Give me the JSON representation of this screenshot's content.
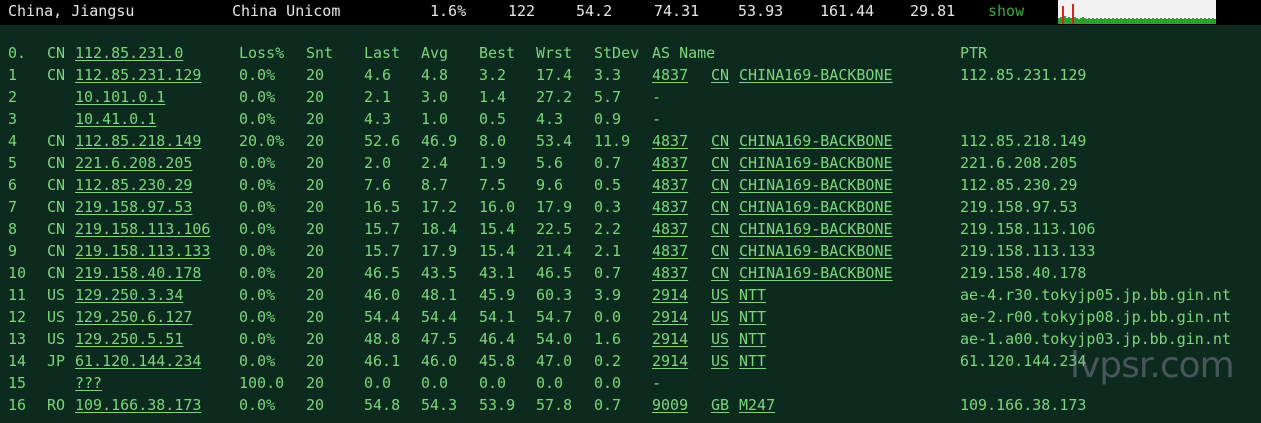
{
  "summary": {
    "location": "China, Jiangsu",
    "isp": "China Unicom",
    "loss": "1.6%",
    "sent": "122",
    "last": "54.2",
    "avg": "74.31",
    "best": "53.93",
    "worst": "161.44",
    "stdev": "29.81",
    "show_label": "show"
  },
  "headers": {
    "hop": "0.",
    "cc": "CN",
    "host": "112.85.231.0",
    "loss": "Loss%",
    "snt": "Snt",
    "last": "Last",
    "avg": "Avg",
    "best": "Best",
    "wrst": "Wrst",
    "stdev": "StDev",
    "asname": "AS Name",
    "ptr": "PTR"
  },
  "hops": [
    {
      "hop": "1",
      "cc": "CN",
      "host": "112.85.231.129",
      "loss": "0.0%",
      "snt": "20",
      "last": "4.6",
      "avg": "4.8",
      "best": "3.2",
      "wrst": "17.4",
      "stdev": "3.3",
      "asn": "4837",
      "ascc": "CN",
      "asname": "CHINA169-BACKBONE",
      "ptr": "112.85.231.129"
    },
    {
      "hop": "2",
      "cc": "",
      "host": "10.101.0.1",
      "loss": "0.0%",
      "snt": "20",
      "last": "2.1",
      "avg": "3.0",
      "best": "1.4",
      "wrst": "27.2",
      "stdev": "5.7",
      "asn": "-",
      "ascc": "",
      "asname": "",
      "ptr": ""
    },
    {
      "hop": "3",
      "cc": "",
      "host": "10.41.0.1",
      "loss": "0.0%",
      "snt": "20",
      "last": "4.3",
      "avg": "1.0",
      "best": "0.5",
      "wrst": "4.3",
      "stdev": "0.9",
      "asn": "-",
      "ascc": "",
      "asname": "",
      "ptr": ""
    },
    {
      "hop": "4",
      "cc": "CN",
      "host": "112.85.218.149",
      "loss": "20.0%",
      "snt": "20",
      "last": "52.6",
      "avg": "46.9",
      "best": "8.0",
      "wrst": "53.4",
      "stdev": "11.9",
      "asn": "4837",
      "ascc": "CN",
      "asname": "CHINA169-BACKBONE",
      "ptr": "112.85.218.149"
    },
    {
      "hop": "5",
      "cc": "CN",
      "host": "221.6.208.205",
      "loss": "0.0%",
      "snt": "20",
      "last": "2.0",
      "avg": "2.4",
      "best": "1.9",
      "wrst": "5.6",
      "stdev": "0.7",
      "asn": "4837",
      "ascc": "CN",
      "asname": "CHINA169-BACKBONE",
      "ptr": "221.6.208.205"
    },
    {
      "hop": "6",
      "cc": "CN",
      "host": "112.85.230.29",
      "loss": "0.0%",
      "snt": "20",
      "last": "7.6",
      "avg": "8.7",
      "best": "7.5",
      "wrst": "9.6",
      "stdev": "0.5",
      "asn": "4837",
      "ascc": "CN",
      "asname": "CHINA169-BACKBONE",
      "ptr": "112.85.230.29"
    },
    {
      "hop": "7",
      "cc": "CN",
      "host": "219.158.97.53",
      "loss": "0.0%",
      "snt": "20",
      "last": "16.5",
      "avg": "17.2",
      "best": "16.0",
      "wrst": "17.9",
      "stdev": "0.3",
      "asn": "4837",
      "ascc": "CN",
      "asname": "CHINA169-BACKBONE",
      "ptr": "219.158.97.53"
    },
    {
      "hop": "8",
      "cc": "CN",
      "host": "219.158.113.106",
      "loss": "0.0%",
      "snt": "20",
      "last": "15.7",
      "avg": "18.4",
      "best": "15.4",
      "wrst": "22.5",
      "stdev": "2.2",
      "asn": "4837",
      "ascc": "CN",
      "asname": "CHINA169-BACKBONE",
      "ptr": "219.158.113.106"
    },
    {
      "hop": "9",
      "cc": "CN",
      "host": "219.158.113.133",
      "loss": "0.0%",
      "snt": "20",
      "last": "15.7",
      "avg": "17.9",
      "best": "15.4",
      "wrst": "21.4",
      "stdev": "2.1",
      "asn": "4837",
      "ascc": "CN",
      "asname": "CHINA169-BACKBONE",
      "ptr": "219.158.113.133"
    },
    {
      "hop": "10",
      "cc": "CN",
      "host": "219.158.40.178",
      "loss": "0.0%",
      "snt": "20",
      "last": "46.5",
      "avg": "43.5",
      "best": "43.1",
      "wrst": "46.5",
      "stdev": "0.7",
      "asn": "4837",
      "ascc": "CN",
      "asname": "CHINA169-BACKBONE",
      "ptr": "219.158.40.178"
    },
    {
      "hop": "11",
      "cc": "US",
      "host": "129.250.3.34",
      "loss": "0.0%",
      "snt": "20",
      "last": "46.0",
      "avg": "48.1",
      "best": "45.9",
      "wrst": "60.3",
      "stdev": "3.9",
      "asn": "2914",
      "ascc": "US",
      "asname": "NTT",
      "ptr": "ae-4.r30.tokyjp05.jp.bb.gin.nt"
    },
    {
      "hop": "12",
      "cc": "US",
      "host": "129.250.6.127",
      "loss": "0.0%",
      "snt": "20",
      "last": "54.4",
      "avg": "54.4",
      "best": "54.1",
      "wrst": "54.7",
      "stdev": "0.0",
      "asn": "2914",
      "ascc": "US",
      "asname": "NTT",
      "ptr": "ae-2.r00.tokyjp08.jp.bb.gin.nt"
    },
    {
      "hop": "13",
      "cc": "US",
      "host": "129.250.5.51",
      "loss": "0.0%",
      "snt": "20",
      "last": "48.8",
      "avg": "47.5",
      "best": "46.4",
      "wrst": "54.0",
      "stdev": "1.6",
      "asn": "2914",
      "ascc": "US",
      "asname": "NTT",
      "ptr": "ae-1.a00.tokyjp03.jp.bb.gin.nt"
    },
    {
      "hop": "14",
      "cc": "JP",
      "host": "61.120.144.234",
      "loss": "0.0%",
      "snt": "20",
      "last": "46.1",
      "avg": "46.0",
      "best": "45.8",
      "wrst": "47.0",
      "stdev": "0.2",
      "asn": "2914",
      "ascc": "US",
      "asname": "NTT",
      "ptr": "61.120.144.234"
    },
    {
      "hop": "15",
      "cc": "",
      "host": "???",
      "loss": "100.0",
      "snt": "20",
      "last": "0.0",
      "avg": "0.0",
      "best": "0.0",
      "wrst": "0.0",
      "stdev": "0.0",
      "asn": "-",
      "ascc": "",
      "asname": "",
      "ptr": ""
    },
    {
      "hop": "16",
      "cc": "RO",
      "host": "109.166.38.173",
      "loss": "0.0%",
      "snt": "20",
      "last": "54.8",
      "avg": "54.3",
      "best": "53.9",
      "wrst": "57.8",
      "stdev": "0.7",
      "asn": "9009",
      "ascc": "GB",
      "asname": "M247",
      "ptr": "109.166.38.173"
    }
  ],
  "watermark": "lvpsr.com",
  "colors": {
    "panel_bg": "#0d2a1f",
    "text_green": "#7cd67c",
    "summary_text": "#e6e6e6",
    "show_green": "#3ea83e",
    "spark_bar": "#2e9e2e",
    "spark_spike": "#e02020"
  }
}
